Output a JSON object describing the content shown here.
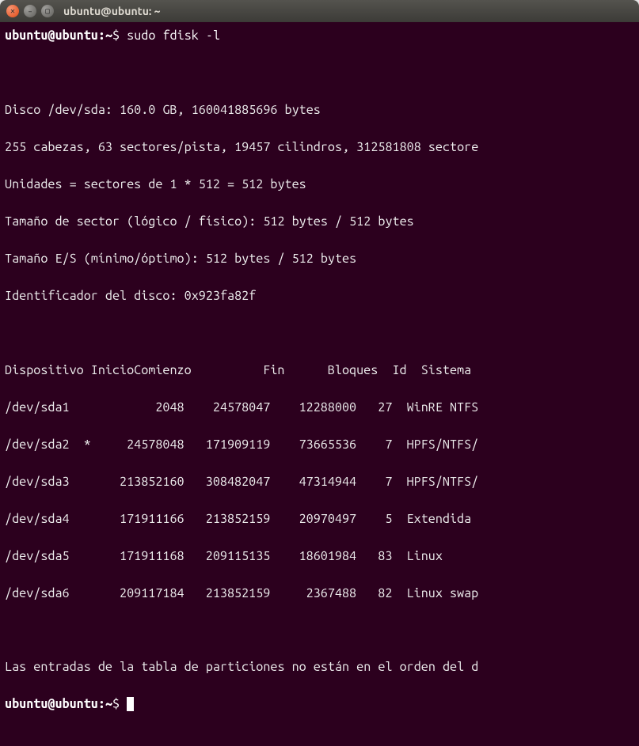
{
  "window": {
    "title": "ubuntu@ubuntu: ~"
  },
  "prompt": {
    "user_host": "ubuntu@ubuntu",
    "sep": ":",
    "path": "~",
    "symbol": "$"
  },
  "command": "sudo fdisk -l",
  "disk_info": {
    "line1": "Disco /dev/sda: 160.0 GB, 160041885696 bytes",
    "line2": "255 cabezas, 63 sectores/pista, 19457 cilindros, 312581808 sectore",
    "line3": "Unidades = sectores de 1 * 512 = 512 bytes",
    "line4": "Tamaño de sector (lógico / físico): 512 bytes / 512 bytes",
    "line5": "Tamaño E/S (mínimo/óptimo): 512 bytes / 512 bytes",
    "line6": "Identificador del disco: 0x923fa82f"
  },
  "table": {
    "headers": {
      "device": "Dispositivo",
      "boot": "Inicio",
      "start": "Comienzo",
      "end": "Fin",
      "blocks": "Bloques",
      "id": "Id",
      "system": "Sistema"
    },
    "rows": [
      {
        "device": "/dev/sda1",
        "boot": "",
        "start": "2048",
        "end": "24578047",
        "blocks": "12288000",
        "id": "27",
        "system": "WinRE NTFS"
      },
      {
        "device": "/dev/sda2",
        "boot": "*",
        "start": "24578048",
        "end": "171909119",
        "blocks": "73665536",
        "id": "7",
        "system": "HPFS/NTFS/"
      },
      {
        "device": "/dev/sda3",
        "boot": "",
        "start": "213852160",
        "end": "308482047",
        "blocks": "47314944",
        "id": "7",
        "system": "HPFS/NTFS/"
      },
      {
        "device": "/dev/sda4",
        "boot": "",
        "start": "171911166",
        "end": "213852159",
        "blocks": "20970497",
        "id": "5",
        "system": "Extendida"
      },
      {
        "device": "/dev/sda5",
        "boot": "",
        "start": "171911168",
        "end": "209115135",
        "blocks": "18601984",
        "id": "83",
        "system": "Linux"
      },
      {
        "device": "/dev/sda6",
        "boot": "",
        "start": "209117184",
        "end": "213852159",
        "blocks": "2367488",
        "id": "82",
        "system": "Linux swap"
      }
    ]
  },
  "footer_note": "Las entradas de la tabla de particiones no están en el orden del d"
}
